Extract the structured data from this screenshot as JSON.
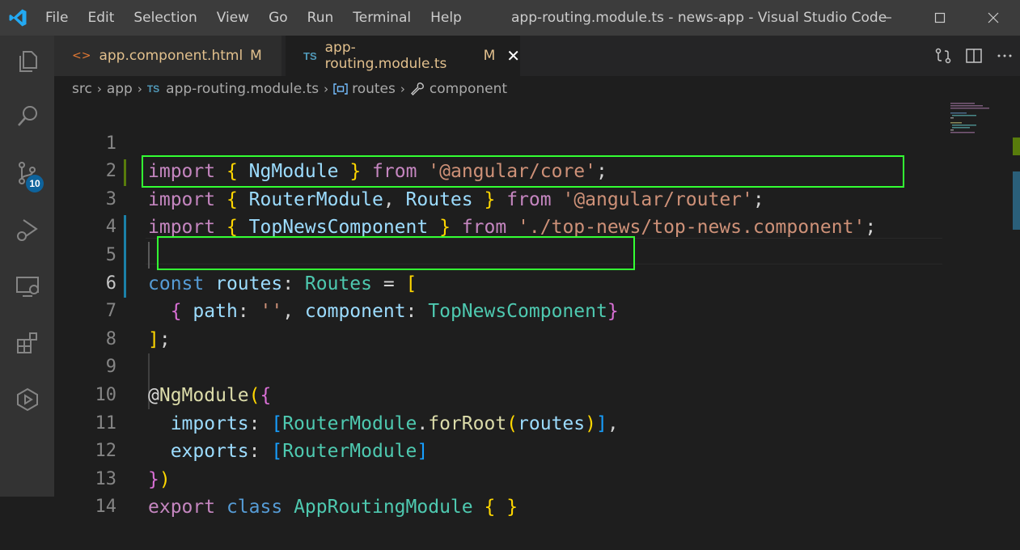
{
  "window": {
    "title": "app-routing.module.ts - news-app - Visual Studio Code",
    "menu": [
      "File",
      "Edit",
      "Selection",
      "View",
      "Go",
      "Run",
      "Terminal",
      "Help"
    ]
  },
  "activity_bar": {
    "items": [
      "explorer",
      "search",
      "source-control",
      "run-debug",
      "remote-explorer",
      "extensions",
      "testing"
    ],
    "source_control_badge": "10"
  },
  "tabs": [
    {
      "label": "app.component.html",
      "status": "M",
      "icon": "<>",
      "active": false
    },
    {
      "label": "app-routing.module.ts",
      "status": "M",
      "icon": "TS",
      "active": true,
      "close": "✕"
    }
  ],
  "breadcrumb": {
    "items": [
      "src",
      "app",
      "app-routing.module.ts",
      "routes",
      "component"
    ],
    "file_icon": "TS"
  },
  "editor": {
    "current_line": 6,
    "line_numbers": [
      "1",
      "2",
      "3",
      "4",
      "5",
      "6",
      "7",
      "8",
      "9",
      "10",
      "11",
      "12",
      "13",
      "14"
    ],
    "lines": [
      "import { NgModule } from '@angular/core';",
      "import { RouterModule, Routes } from '@angular/router';",
      "import { TopNewsComponent } from './top-news/top-news.component';",
      "",
      "const routes: Routes = [",
      "  { path: '', component: TopNewsComponent}",
      "];",
      "",
      "@NgModule({",
      "  imports: [RouterModule.forRoot(routes)],",
      "  exports: [RouterModule]",
      "})",
      "export class AppRoutingModule { }",
      ""
    ]
  },
  "colors": {
    "highlight_box": "#33ff33",
    "modified_tab_text": "#e2c08d",
    "badge": "#0e639c"
  }
}
